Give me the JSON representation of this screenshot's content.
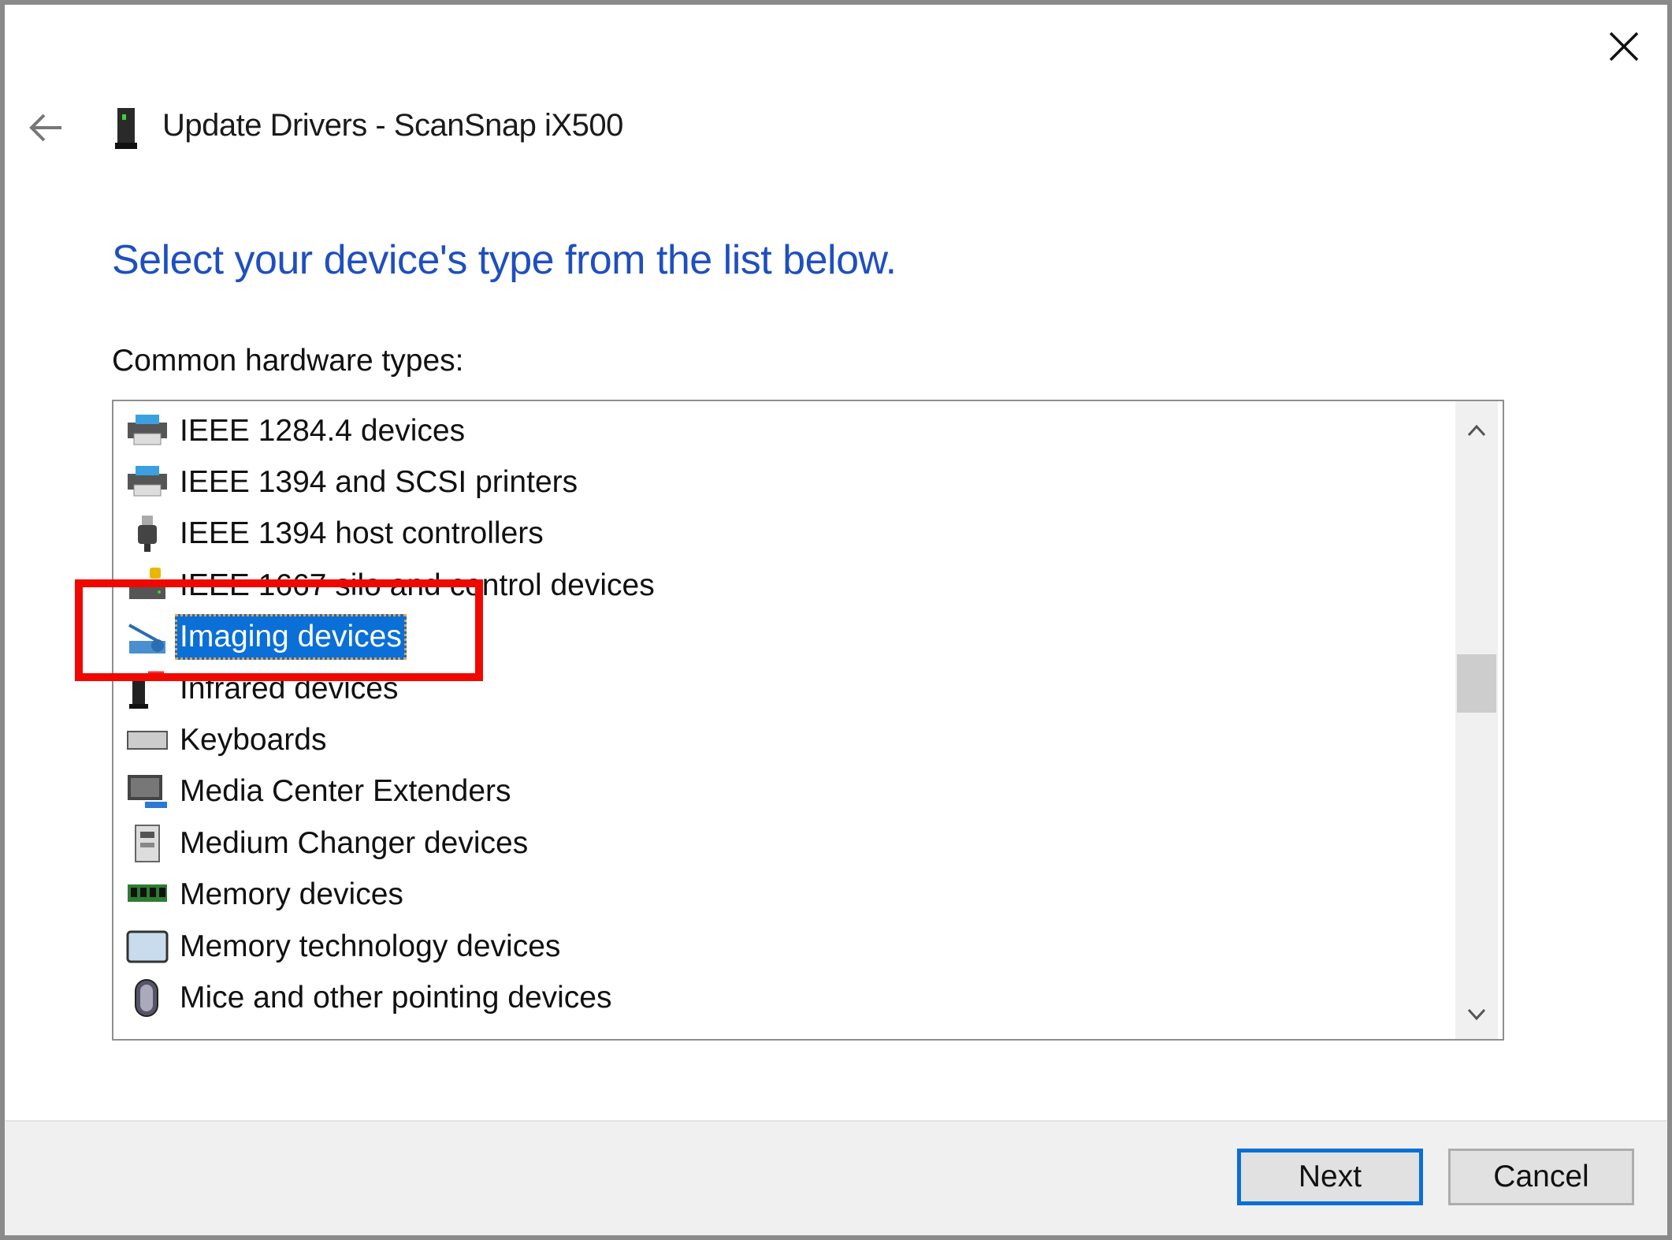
{
  "window": {
    "title": "Update Drivers -  ScanSnap iX500",
    "close_icon": "close-icon",
    "back_icon": "back-arrow-icon",
    "device_icon": "scanner-icon"
  },
  "main": {
    "heading": "Select your device's type from the list below.",
    "list_label": "Common hardware types:",
    "items": [
      {
        "label": "IEEE 1284.4 devices",
        "icon": "printer-icon"
      },
      {
        "label": "IEEE 1394 and SCSI printers",
        "icon": "printer-icon"
      },
      {
        "label": "IEEE 1394 host controllers",
        "icon": "usb-plug-icon"
      },
      {
        "label": "IEEE 1667 silo and control devices",
        "icon": "lock-drive-icon"
      },
      {
        "label": "Imaging devices",
        "icon": "camera-scanner-icon",
        "selected": true
      },
      {
        "label": "Infrared devices",
        "icon": "infrared-icon"
      },
      {
        "label": "Keyboards",
        "icon": "keyboard-icon"
      },
      {
        "label": "Media Center Extenders",
        "icon": "monitor-icon"
      },
      {
        "label": "Medium Changer devices",
        "icon": "tower-icon"
      },
      {
        "label": "Memory devices",
        "icon": "memory-icon"
      },
      {
        "label": "Memory technology devices",
        "icon": "memory-card-icon"
      },
      {
        "label": "Mice and other pointing devices",
        "icon": "mouse-icon"
      }
    ],
    "scroll_position": 0.45,
    "highlight_color": "#f00800",
    "selection_color": "#0a6fd6"
  },
  "footer": {
    "next": "Next",
    "cancel": "Cancel"
  }
}
